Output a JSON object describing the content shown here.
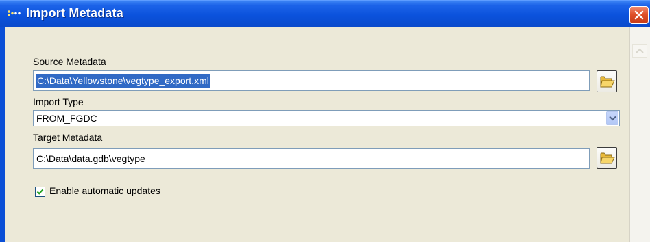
{
  "window": {
    "title": "Import Metadata",
    "close_icon": "close-icon"
  },
  "form": {
    "source": {
      "label": "Source Metadata",
      "value": "C:\\Data\\Yellowstone\\vegtype_export.xml",
      "browse_icon": "folder-open-icon"
    },
    "import_type": {
      "label": "Import Type",
      "selected": "FROM_FGDC"
    },
    "target": {
      "label": "Target Metadata",
      "value": "C:\\Data\\data.gdb\\vegtype",
      "browse_icon": "folder-open-icon"
    },
    "auto_update": {
      "label": "Enable automatic updates",
      "checked": true
    }
  },
  "colors": {
    "titlebar": "#0a52dc",
    "dialog_bg": "#ece9d8",
    "selection": "#316ac5",
    "close_button": "#e0512b"
  }
}
